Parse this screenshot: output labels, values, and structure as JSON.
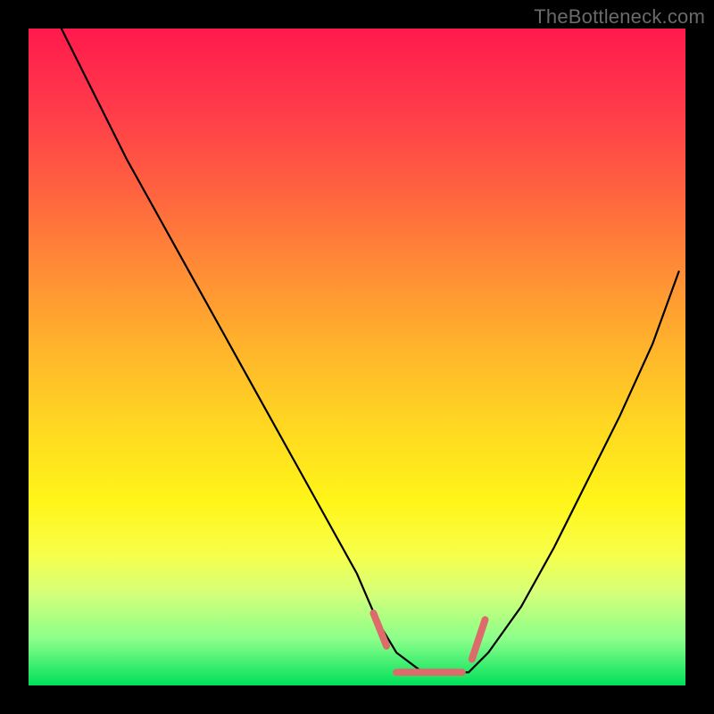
{
  "watermark": "TheBottleneck.com",
  "chart_data": {
    "type": "line",
    "title": "",
    "xlabel": "",
    "ylabel": "",
    "xlim": [
      0,
      100
    ],
    "ylim": [
      0,
      100
    ],
    "grid": false,
    "legend": false,
    "series": [
      {
        "name": "bottleneck-curve",
        "x": [
          5,
          10,
          15,
          20,
          25,
          30,
          35,
          40,
          45,
          50,
          53,
          56,
          60,
          64,
          67,
          70,
          75,
          80,
          85,
          90,
          95,
          99
        ],
        "values": [
          100,
          90,
          80,
          71,
          62,
          53,
          44,
          35,
          26,
          17,
          10,
          5,
          2,
          2,
          2,
          5,
          12,
          21,
          31,
          41,
          52,
          63
        ]
      }
    ],
    "annotations": [
      {
        "name": "optimal-flat-left-entry",
        "type": "segment",
        "x": [
          52.5,
          54.5
        ],
        "y": [
          11,
          6
        ],
        "color": "#dd6b6b"
      },
      {
        "name": "optimal-flat-region",
        "type": "segment",
        "x": [
          56,
          66
        ],
        "y": [
          2,
          2
        ],
        "color": "#dd6b6b"
      },
      {
        "name": "optimal-flat-right-exit",
        "type": "segment",
        "x": [
          67.5,
          69.5
        ],
        "y": [
          4,
          10
        ],
        "color": "#dd6b6b"
      }
    ]
  }
}
